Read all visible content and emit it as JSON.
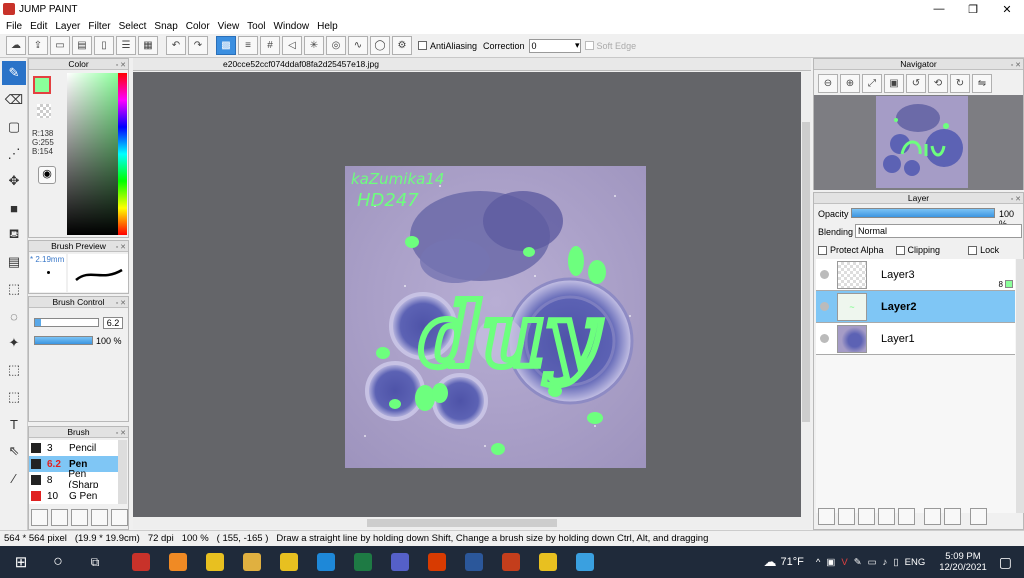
{
  "window": {
    "title": "JUMP PAINT",
    "controls": [
      "—",
      "❐",
      "✕"
    ]
  },
  "menu": [
    "File",
    "Edit",
    "Layer",
    "Filter",
    "Select",
    "Snap",
    "Color",
    "View",
    "Tool",
    "Window",
    "Help"
  ],
  "toolbar": {
    "antialiasing_label": "AntiAliasing",
    "correction_label": "Correction",
    "correction_value": "0",
    "soft_edge_label": "Soft Edge"
  },
  "document_tab": "e20cce52ccf074ddaf08fa2d25457e18.jpg",
  "color_panel": {
    "title": "Color",
    "r": "R:138",
    "g": "G:255",
    "b": "B:154",
    "current_color": "#8aff9a"
  },
  "brush_preview": {
    "title": "Brush Preview",
    "size_label": "* 2.19mm"
  },
  "brush_control": {
    "title": "Brush Control",
    "size_value": "6.2",
    "opacity_value": "100 %",
    "opacity_fraction": 1.0
  },
  "brush_panel": {
    "title": "Brush",
    "items": [
      {
        "size": "3",
        "name": "Pencil",
        "selected": false,
        "color": "#222222"
      },
      {
        "size": "6.2",
        "name": "Pen",
        "selected": true,
        "color": "#222222"
      },
      {
        "size": "8",
        "name": "Pen (Sharp",
        "selected": false,
        "color": "#222222"
      },
      {
        "size": "10",
        "name": "G Pen",
        "selected": false,
        "color": "#e02020"
      }
    ]
  },
  "navigator": {
    "title": "Navigator"
  },
  "layer_panel": {
    "title": "Layer",
    "opacity_label": "Opacity",
    "opacity_value": "100 %",
    "opacity_fraction": 1.0,
    "blending_label": "Blending",
    "blending_value": "Normal",
    "protect_alpha_label": "Protect Alpha",
    "clipping_label": "Clipping",
    "lock_label": "Lock",
    "layers": [
      {
        "name": "Layer3",
        "badge": "8",
        "selected": false
      },
      {
        "name": "Layer2",
        "badge": "",
        "selected": true
      },
      {
        "name": "Layer1",
        "badge": "",
        "selected": false
      }
    ]
  },
  "artwork": {
    "handwriting_line1": "kaZumika14",
    "handwriting_line2": "HD247",
    "center_word": "duy"
  },
  "status": {
    "size": "564 * 564 pixel",
    "physical": "(19.9 * 19.9cm)",
    "dpi": "72 dpi",
    "zoom": "100 %",
    "coords": "( 155, -165 )",
    "hint": "Draw a straight line by holding down Shift, Change a brush size by holding down Ctrl, Alt, and dragging"
  },
  "taskbar": {
    "weather": "71°F",
    "language": "ENG",
    "time": "5:09 PM",
    "date": "12/20/2021",
    "apps": [
      "jump-paint",
      "sublime",
      "chrome",
      "explorer",
      "chrome-2",
      "edge",
      "excel",
      "teams",
      "office",
      "word",
      "powerpoint",
      "chrome-3",
      "photos"
    ],
    "app_colors": [
      "#c8322a",
      "#f08a24",
      "#e8c020",
      "#e0b040",
      "#e8c020",
      "#1e88d8",
      "#1e7a44",
      "#5560c8",
      "#d83b01",
      "#2b579a",
      "#c43e1c",
      "#e8c020",
      "#3aa0e0"
    ]
  }
}
